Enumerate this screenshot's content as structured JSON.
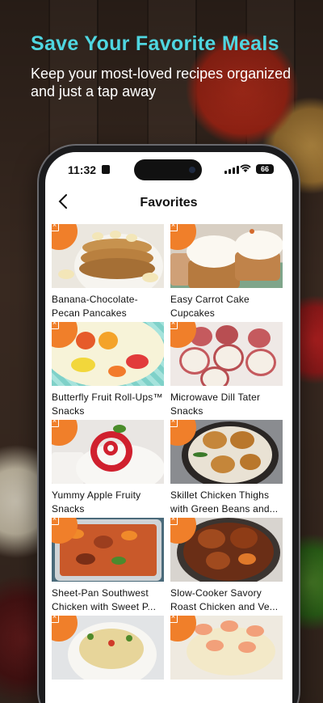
{
  "promo": {
    "headline": "Save Your Favorite Meals",
    "subline": "Keep your most-loved recipes organized and just a tap away"
  },
  "status_bar": {
    "time": "11:32",
    "battery": "66"
  },
  "nav": {
    "back_icon": "chevron-left-icon",
    "title": "Favorites"
  },
  "accent_color": "#f07f2a",
  "headline_color": "#4fd6e0",
  "favorites": [
    {
      "title": "Banana-Chocolate-Pecan Pancakes"
    },
    {
      "title": "Easy Carrot Cake Cupcakes"
    },
    {
      "title": "Butterfly Fruit Roll-Ups™ Snacks"
    },
    {
      "title": "Microwave Dill Tater Snacks"
    },
    {
      "title": "Yummy Apple Fruity Snacks"
    },
    {
      "title": "Skillet Chicken Thighs with Green Beans and..."
    },
    {
      "title": "Sheet-Pan Southwest Chicken with Sweet P..."
    },
    {
      "title": "Slow-Cooker Savory Roast Chicken and Ve..."
    },
    {
      "title": ""
    },
    {
      "title": ""
    }
  ],
  "remove_favorite_icon": "trash-icon"
}
